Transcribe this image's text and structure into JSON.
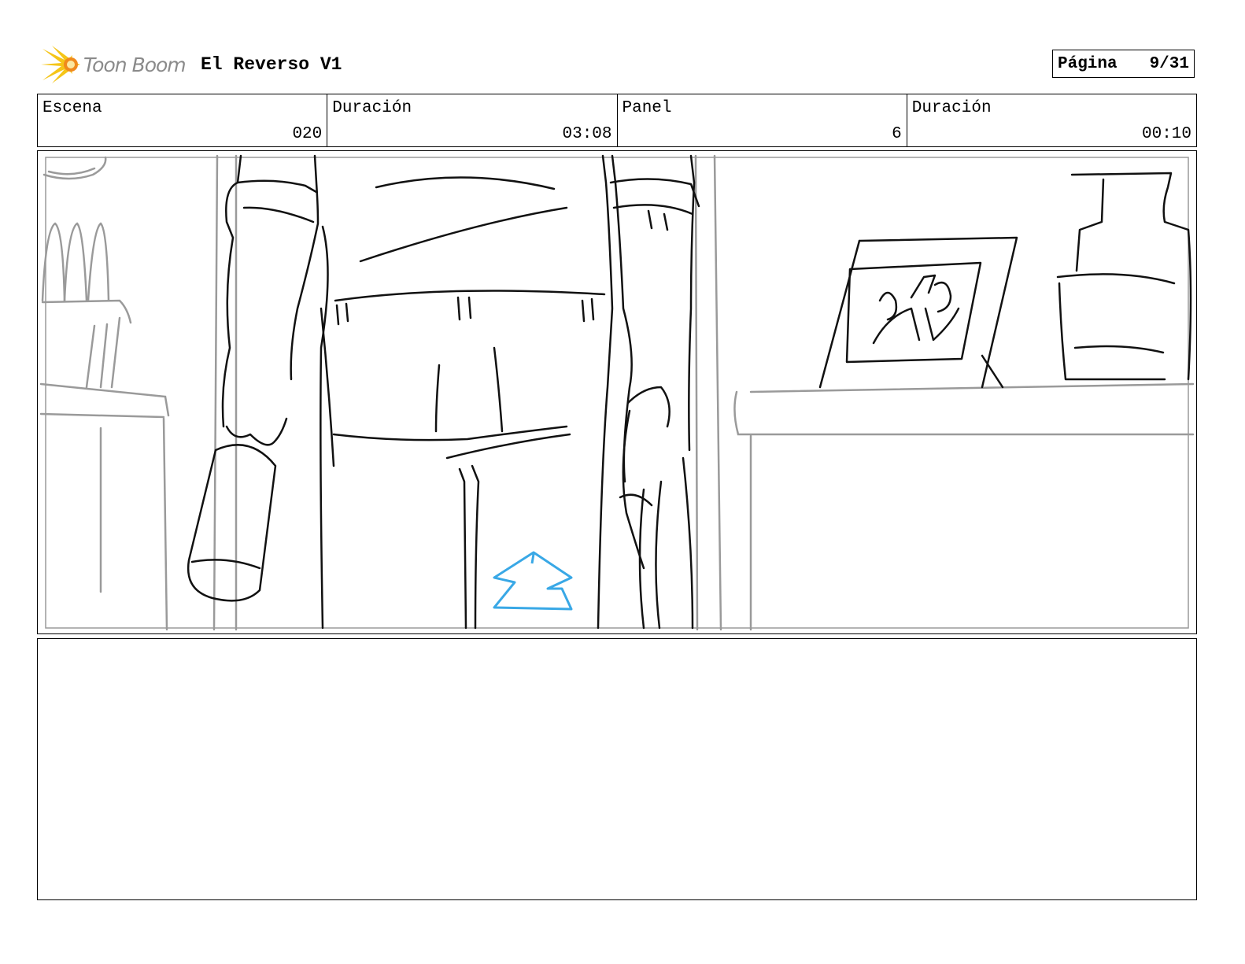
{
  "header": {
    "logo_text": "Toon Boom",
    "project_title": "El Reverso V1",
    "page_label": "Página",
    "page_number": "9/31"
  },
  "info": {
    "scene_label": "Escena",
    "scene_value": "020",
    "scene_duration_label": "Duración",
    "scene_duration_value": "03:08",
    "panel_label": "Panel",
    "panel_value": "6",
    "panel_duration_label": "Duración",
    "panel_duration_value": "00:10"
  },
  "notes": {
    "text": ""
  },
  "colors": {
    "logo_yellow": "#f5c518",
    "logo_orange": "#f08a1c",
    "sketch_black": "#111111",
    "sketch_gray": "#9a9a9a",
    "arrow_blue": "#39a8e6"
  }
}
